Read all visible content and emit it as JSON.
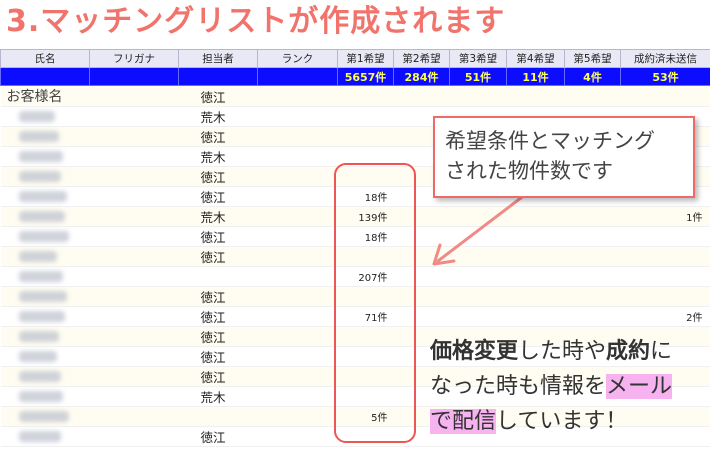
{
  "title": "3.マッチングリストが作成されます",
  "table": {
    "headers": [
      "氏名",
      "フリガナ",
      "担当者",
      "ランク",
      "第1希望",
      "第2希望",
      "第3希望",
      "第4希望",
      "第5希望",
      "成約済未送信"
    ],
    "totals": [
      "",
      "",
      "",
      "",
      "5657件",
      "284件",
      "51件",
      "11件",
      "4件",
      "53件"
    ],
    "rows": [
      {
        "name": "お客様名",
        "blur": 0,
        "staff": "徳江",
        "w1": "",
        "sent": ""
      },
      {
        "name": "",
        "blur": 36,
        "staff": "荒木",
        "w1": "",
        "sent": ""
      },
      {
        "name": "",
        "blur": 40,
        "staff": "徳江",
        "w1": "",
        "sent": ""
      },
      {
        "name": "",
        "blur": 44,
        "staff": "荒木",
        "w1": "",
        "sent": ""
      },
      {
        "name": "",
        "blur": 42,
        "staff": "徳江",
        "w1": "",
        "sent": ""
      },
      {
        "name": "",
        "blur": 48,
        "staff": "徳江",
        "w1": "18件",
        "sent": ""
      },
      {
        "name": "",
        "blur": 46,
        "staff": "荒木",
        "w1": "139件",
        "sent": "1件"
      },
      {
        "name": "",
        "blur": 50,
        "staff": "徳江",
        "w1": "18件",
        "sent": ""
      },
      {
        "name": "",
        "blur": 38,
        "staff": "徳江",
        "w1": "",
        "sent": ""
      },
      {
        "name": "",
        "blur": 44,
        "staff": "",
        "w1": "207件",
        "sent": ""
      },
      {
        "name": "",
        "blur": 48,
        "staff": "徳江",
        "w1": "",
        "sent": ""
      },
      {
        "name": "",
        "blur": 46,
        "staff": "徳江",
        "w1": "71件",
        "sent": "2件"
      },
      {
        "name": "",
        "blur": 40,
        "staff": "徳江",
        "w1": "",
        "sent": ""
      },
      {
        "name": "",
        "blur": 38,
        "staff": "徳江",
        "w1": "",
        "sent": ""
      },
      {
        "name": "",
        "blur": 42,
        "staff": "徳江",
        "w1": "",
        "sent": ""
      },
      {
        "name": "",
        "blur": 44,
        "staff": "荒木",
        "w1": "",
        "sent": ""
      },
      {
        "name": "",
        "blur": 50,
        "staff": "",
        "w1": "5件",
        "sent": ""
      },
      {
        "name": "",
        "blur": 42,
        "staff": "徳江",
        "w1": "",
        "sent": ""
      }
    ]
  },
  "callout": {
    "line1": "希望条件とマッチング",
    "line2": "された物件数です"
  },
  "note": {
    "p1": "価格変更",
    "p2": "した時や",
    "p3": "成約",
    "p4": "に",
    "p5": "なった時も情報を",
    "p6": "メール",
    "p7": "で配信",
    "p8": "しています！"
  },
  "colors": {
    "title": "#f0746c",
    "totals_bg": "#0c0cff",
    "totals_text": "#ffff55",
    "highlight_border": "#ee5555",
    "marker_pink": "#f6b3f0"
  }
}
